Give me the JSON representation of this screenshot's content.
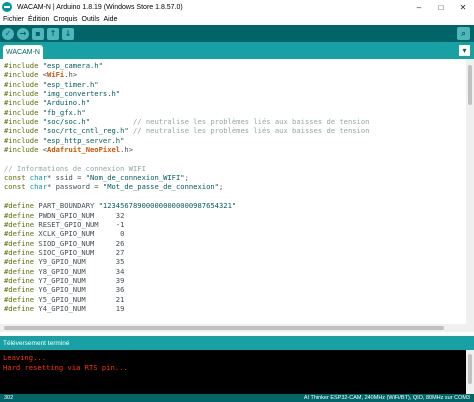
{
  "window": {
    "title": "WACAM-N | Arduino 1.8.19 (Windows Store 1.8.57.0)",
    "minimize_glyph": "–",
    "maximize_glyph": "□",
    "close_glyph": "✕"
  },
  "menu": {
    "items": [
      "Fichier",
      "Édition",
      "Croquis",
      "Outils",
      "Aide"
    ]
  },
  "toolbar": {
    "verify_glyph": "✓",
    "upload_glyph": "→",
    "new_glyph": "▪",
    "open_glyph": "↑",
    "save_glyph": "↓",
    "serial_glyph": "⌕"
  },
  "tabs": {
    "active": "WACAM-N",
    "menu_glyph": "▾"
  },
  "colors": {
    "toolbar": "#006468",
    "tabbar": "#17a1a5",
    "button": "#4db7bb",
    "console_text": "#ff3300"
  },
  "editor": {
    "lines": [
      [
        {
          "t": "#include ",
          "c": "kw"
        },
        {
          "t": "\"esp_camera.h\"",
          "c": "st"
        }
      ],
      [
        {
          "t": "#include ",
          "c": "kw"
        },
        {
          "t": "<",
          "c": "pl"
        },
        {
          "t": "WiFi",
          "c": "lib"
        },
        {
          "t": ".h>",
          "c": "pl"
        }
      ],
      [
        {
          "t": "#include ",
          "c": "kw"
        },
        {
          "t": "\"esp_timer.h\"",
          "c": "st"
        }
      ],
      [
        {
          "t": "#include ",
          "c": "kw"
        },
        {
          "t": "\"img_converters.h\"",
          "c": "st"
        }
      ],
      [
        {
          "t": "#include ",
          "c": "kw"
        },
        {
          "t": "\"Arduino.h\"",
          "c": "st"
        }
      ],
      [
        {
          "t": "#include ",
          "c": "kw"
        },
        {
          "t": "\"fb_gfx.h\"",
          "c": "st"
        }
      ],
      [
        {
          "t": "#include ",
          "c": "kw"
        },
        {
          "t": "\"soc/soc.h\"",
          "c": "st"
        },
        {
          "t": "          // neutralise les problèmes liés aux baisses de tension",
          "c": "cm"
        }
      ],
      [
        {
          "t": "#include ",
          "c": "kw"
        },
        {
          "t": "\"soc/rtc_cntl_reg.h\"",
          "c": "st"
        },
        {
          "t": " // neutralise les problèmes liés aux baisses de tension",
          "c": "cm"
        }
      ],
      [
        {
          "t": "#include ",
          "c": "kw"
        },
        {
          "t": "\"esp_http_server.h\"",
          "c": "st"
        }
      ],
      [
        {
          "t": "#include ",
          "c": "kw"
        },
        {
          "t": "<",
          "c": "pl"
        },
        {
          "t": "Adafruit_NeoPixel",
          "c": "lib"
        },
        {
          "t": ".h>",
          "c": "pl"
        }
      ],
      [],
      [
        {
          "t": "// Informations de connexion WIFI",
          "c": "cm"
        }
      ],
      [
        {
          "t": "const ",
          "c": "kw"
        },
        {
          "t": "char",
          "c": "ty"
        },
        {
          "t": "* ssid = ",
          "c": "pl"
        },
        {
          "t": "\"Nom_de_connexion_WIFI\"",
          "c": "st"
        },
        {
          "t": ";",
          "c": "pl"
        }
      ],
      [
        {
          "t": "const ",
          "c": "kw"
        },
        {
          "t": "char",
          "c": "ty"
        },
        {
          "t": "* password = ",
          "c": "pl"
        },
        {
          "t": "\"Mot_de_passe_de_connexion\"",
          "c": "st"
        },
        {
          "t": ";",
          "c": "pl"
        }
      ],
      [],
      [
        {
          "t": "#define ",
          "c": "kw"
        },
        {
          "t": "PART_BOUNDARY ",
          "c": "pl"
        },
        {
          "t": "\"123456789000000000000987654321\"",
          "c": "st"
        }
      ],
      [
        {
          "t": "#define ",
          "c": "kw"
        },
        {
          "t": "PWDN_GPIO_NUM     32",
          "c": "pl"
        }
      ],
      [
        {
          "t": "#define ",
          "c": "kw"
        },
        {
          "t": "RESET_GPIO_NUM    -1",
          "c": "pl"
        }
      ],
      [
        {
          "t": "#define ",
          "c": "kw"
        },
        {
          "t": "XCLK_GPIO_NUM      0",
          "c": "pl"
        }
      ],
      [
        {
          "t": "#define ",
          "c": "kw"
        },
        {
          "t": "SIOD_GPIO_NUM     26",
          "c": "pl"
        }
      ],
      [
        {
          "t": "#define ",
          "c": "kw"
        },
        {
          "t": "SIOC_GPIO_NUM     27",
          "c": "pl"
        }
      ],
      [
        {
          "t": "#define ",
          "c": "kw"
        },
        {
          "t": "Y9_GPIO_NUM       35",
          "c": "pl"
        }
      ],
      [
        {
          "t": "#define ",
          "c": "kw"
        },
        {
          "t": "Y8_GPIO_NUM       34",
          "c": "pl"
        }
      ],
      [
        {
          "t": "#define ",
          "c": "kw"
        },
        {
          "t": "Y7_GPIO_NUM       39",
          "c": "pl"
        }
      ],
      [
        {
          "t": "#define ",
          "c": "kw"
        },
        {
          "t": "Y6_GPIO_NUM       36",
          "c": "pl"
        }
      ],
      [
        {
          "t": "#define ",
          "c": "kw"
        },
        {
          "t": "Y5_GPIO_NUM       21",
          "c": "pl"
        }
      ],
      [
        {
          "t": "#define ",
          "c": "kw"
        },
        {
          "t": "Y4_GPIO_NUM       19",
          "c": "pl"
        }
      ]
    ]
  },
  "status": {
    "message": "Téléversement terminé"
  },
  "console": {
    "lines": [
      "Leaving...",
      "Hard resetting via RTS pin..."
    ]
  },
  "footer": {
    "line_number": "302",
    "board_info": "AI Thinker ESP32-CAM, 240MHz (WiFi/BT), QIO, 80MHz sur COM3"
  }
}
